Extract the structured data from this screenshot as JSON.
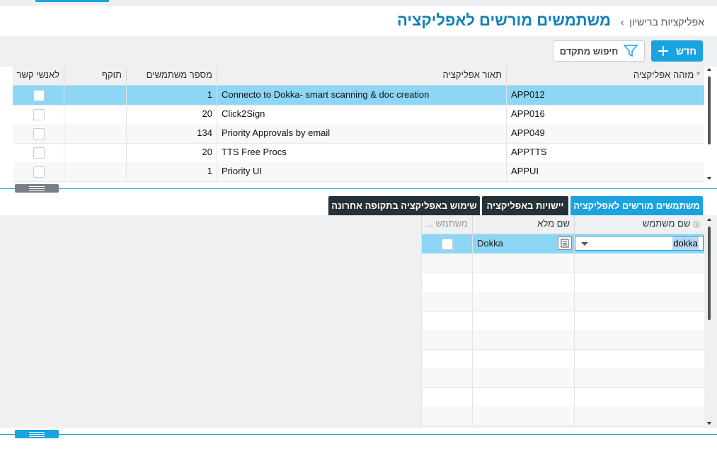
{
  "header": {
    "breadcrumb": "אפליקציות ברישיון",
    "breadcrumb_sep": "›",
    "title": "משתמשים מורשים לאפליקציה"
  },
  "toolbar": {
    "new_label": "חדש",
    "advanced_search_label": "חיפוש מתקדם"
  },
  "apps_table": {
    "required_mark": "*",
    "columns": {
      "app_id": "מזהה אפליקציה",
      "app_desc": "תאור אפליקציה",
      "user_count": "מספר משתמשים",
      "validity": "תוקף",
      "contacts": "לאנשי קשר"
    },
    "rows": [
      {
        "app_id": "APP012",
        "app_desc": "Connecto to Dokka- smart scanning & doc creation",
        "user_count": "1",
        "validity": "",
        "selected": true
      },
      {
        "app_id": "APP016",
        "app_desc": "Click2Sign",
        "user_count": "20",
        "validity": ""
      },
      {
        "app_id": "APP049",
        "app_desc": "Priority Approvals by email",
        "user_count": "134",
        "validity": ""
      },
      {
        "app_id": "APPTTS",
        "app_desc": "TTS Free Procs",
        "user_count": "20",
        "validity": ""
      },
      {
        "app_id": "APPUI",
        "app_desc": "Priority UI",
        "user_count": "1",
        "validity": ""
      }
    ]
  },
  "subtabs": {
    "tab1": "משתמשים מורשים לאפליקציה",
    "tab2": "יישויות באפליקציה",
    "tab3": "שימוש באפליקציה בתקופה אחרונה"
  },
  "users_table": {
    "columns": {
      "username": "שם משתמש",
      "fullname": "שם מלא",
      "user_flag": "משתמש ..."
    },
    "rows": [
      {
        "username": "dokka",
        "fullname": "Dokka"
      }
    ]
  },
  "colors": {
    "accent": "#1aa3e0",
    "title": "#0f7fb8",
    "selected_row": "#8dd6f5",
    "dark_tab": "#263238"
  },
  "icons": [
    "plus-icon",
    "filter-icon",
    "chevron-left-icon",
    "dropdown-arrow-icon",
    "document-icon",
    "column-info-icon",
    "splitter-handle-icon"
  ]
}
